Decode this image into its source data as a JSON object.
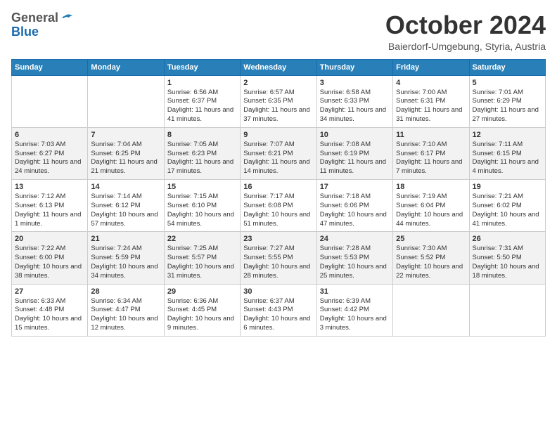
{
  "header": {
    "logo_general": "General",
    "logo_blue": "Blue",
    "month_title": "October 2024",
    "subtitle": "Baierdorf-Umgebung, Styria, Austria"
  },
  "weekdays": [
    "Sunday",
    "Monday",
    "Tuesday",
    "Wednesday",
    "Thursday",
    "Friday",
    "Saturday"
  ],
  "weeks": [
    [
      {
        "day": "",
        "info": ""
      },
      {
        "day": "",
        "info": ""
      },
      {
        "day": "1",
        "info": "Sunrise: 6:56 AM\nSunset: 6:37 PM\nDaylight: 11 hours and 41 minutes."
      },
      {
        "day": "2",
        "info": "Sunrise: 6:57 AM\nSunset: 6:35 PM\nDaylight: 11 hours and 37 minutes."
      },
      {
        "day": "3",
        "info": "Sunrise: 6:58 AM\nSunset: 6:33 PM\nDaylight: 11 hours and 34 minutes."
      },
      {
        "day": "4",
        "info": "Sunrise: 7:00 AM\nSunset: 6:31 PM\nDaylight: 11 hours and 31 minutes."
      },
      {
        "day": "5",
        "info": "Sunrise: 7:01 AM\nSunset: 6:29 PM\nDaylight: 11 hours and 27 minutes."
      }
    ],
    [
      {
        "day": "6",
        "info": "Sunrise: 7:03 AM\nSunset: 6:27 PM\nDaylight: 11 hours and 24 minutes."
      },
      {
        "day": "7",
        "info": "Sunrise: 7:04 AM\nSunset: 6:25 PM\nDaylight: 11 hours and 21 minutes."
      },
      {
        "day": "8",
        "info": "Sunrise: 7:05 AM\nSunset: 6:23 PM\nDaylight: 11 hours and 17 minutes."
      },
      {
        "day": "9",
        "info": "Sunrise: 7:07 AM\nSunset: 6:21 PM\nDaylight: 11 hours and 14 minutes."
      },
      {
        "day": "10",
        "info": "Sunrise: 7:08 AM\nSunset: 6:19 PM\nDaylight: 11 hours and 11 minutes."
      },
      {
        "day": "11",
        "info": "Sunrise: 7:10 AM\nSunset: 6:17 PM\nDaylight: 11 hours and 7 minutes."
      },
      {
        "day": "12",
        "info": "Sunrise: 7:11 AM\nSunset: 6:15 PM\nDaylight: 11 hours and 4 minutes."
      }
    ],
    [
      {
        "day": "13",
        "info": "Sunrise: 7:12 AM\nSunset: 6:13 PM\nDaylight: 11 hours and 1 minute."
      },
      {
        "day": "14",
        "info": "Sunrise: 7:14 AM\nSunset: 6:12 PM\nDaylight: 10 hours and 57 minutes."
      },
      {
        "day": "15",
        "info": "Sunrise: 7:15 AM\nSunset: 6:10 PM\nDaylight: 10 hours and 54 minutes."
      },
      {
        "day": "16",
        "info": "Sunrise: 7:17 AM\nSunset: 6:08 PM\nDaylight: 10 hours and 51 minutes."
      },
      {
        "day": "17",
        "info": "Sunrise: 7:18 AM\nSunset: 6:06 PM\nDaylight: 10 hours and 47 minutes."
      },
      {
        "day": "18",
        "info": "Sunrise: 7:19 AM\nSunset: 6:04 PM\nDaylight: 10 hours and 44 minutes."
      },
      {
        "day": "19",
        "info": "Sunrise: 7:21 AM\nSunset: 6:02 PM\nDaylight: 10 hours and 41 minutes."
      }
    ],
    [
      {
        "day": "20",
        "info": "Sunrise: 7:22 AM\nSunset: 6:00 PM\nDaylight: 10 hours and 38 minutes."
      },
      {
        "day": "21",
        "info": "Sunrise: 7:24 AM\nSunset: 5:59 PM\nDaylight: 10 hours and 34 minutes."
      },
      {
        "day": "22",
        "info": "Sunrise: 7:25 AM\nSunset: 5:57 PM\nDaylight: 10 hours and 31 minutes."
      },
      {
        "day": "23",
        "info": "Sunrise: 7:27 AM\nSunset: 5:55 PM\nDaylight: 10 hours and 28 minutes."
      },
      {
        "day": "24",
        "info": "Sunrise: 7:28 AM\nSunset: 5:53 PM\nDaylight: 10 hours and 25 minutes."
      },
      {
        "day": "25",
        "info": "Sunrise: 7:30 AM\nSunset: 5:52 PM\nDaylight: 10 hours and 22 minutes."
      },
      {
        "day": "26",
        "info": "Sunrise: 7:31 AM\nSunset: 5:50 PM\nDaylight: 10 hours and 18 minutes."
      }
    ],
    [
      {
        "day": "27",
        "info": "Sunrise: 6:33 AM\nSunset: 4:48 PM\nDaylight: 10 hours and 15 minutes."
      },
      {
        "day": "28",
        "info": "Sunrise: 6:34 AM\nSunset: 4:47 PM\nDaylight: 10 hours and 12 minutes."
      },
      {
        "day": "29",
        "info": "Sunrise: 6:36 AM\nSunset: 4:45 PM\nDaylight: 10 hours and 9 minutes."
      },
      {
        "day": "30",
        "info": "Sunrise: 6:37 AM\nSunset: 4:43 PM\nDaylight: 10 hours and 6 minutes."
      },
      {
        "day": "31",
        "info": "Sunrise: 6:39 AM\nSunset: 4:42 PM\nDaylight: 10 hours and 3 minutes."
      },
      {
        "day": "",
        "info": ""
      },
      {
        "day": "",
        "info": ""
      }
    ]
  ]
}
